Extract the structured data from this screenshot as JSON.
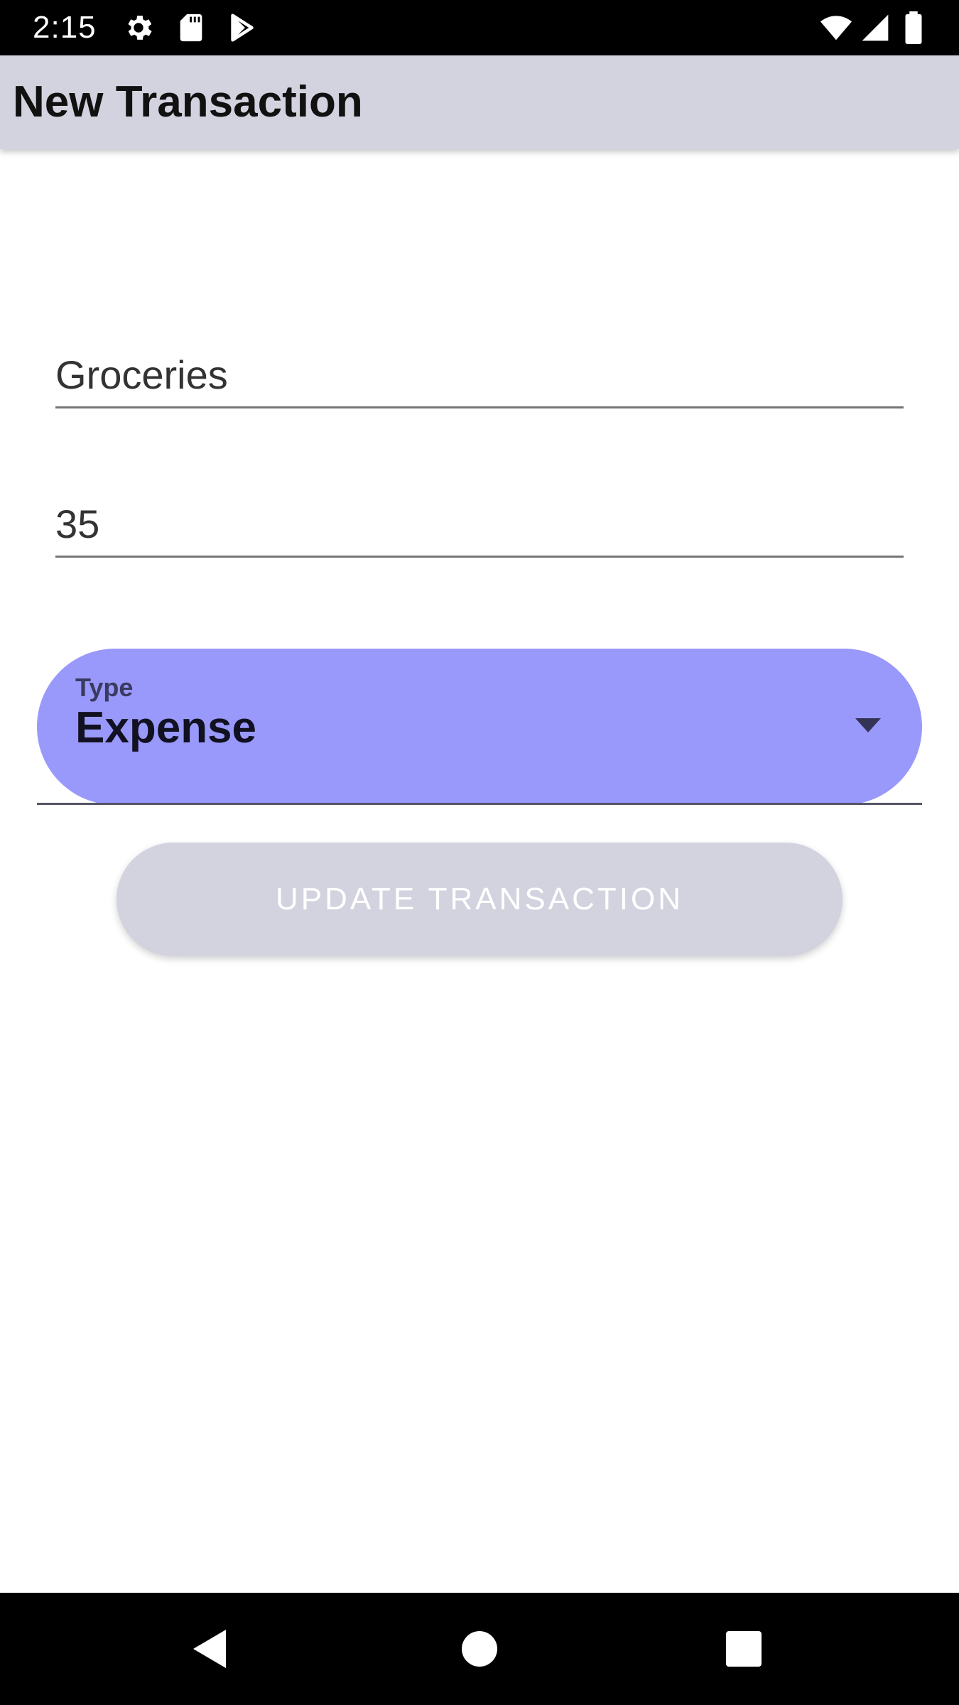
{
  "status_bar": {
    "time": "2:15",
    "left_icons": [
      "gear-icon",
      "sd-card-icon",
      "play-store-icon"
    ],
    "right_icons": [
      "wifi-icon",
      "signal-icon",
      "battery-icon"
    ]
  },
  "app_bar": {
    "title": "New Transaction"
  },
  "form": {
    "description_value": "Groceries",
    "amount_value": "35",
    "type_label": "Type",
    "type_value": "Expense",
    "submit_label": "UPDATE TRANSACTION"
  },
  "nav_bar": {
    "buttons": [
      "back-icon",
      "home-icon",
      "recents-icon"
    ]
  },
  "colors": {
    "app_bar_bg": "#d3d3e0",
    "dropdown_bg": "#9999fb",
    "button_bg": "#d3d3e0"
  }
}
